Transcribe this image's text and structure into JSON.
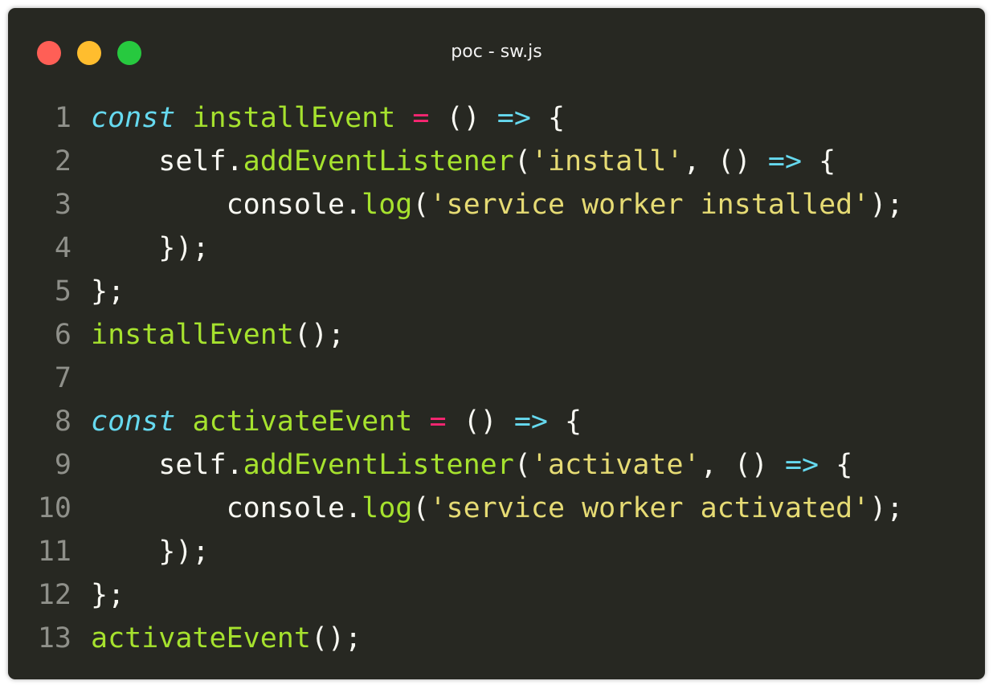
{
  "window": {
    "title": "poc - sw.js",
    "controls": [
      {
        "name": "close",
        "color": "#ff5f56"
      },
      {
        "name": "minimize",
        "color": "#ffbd2e"
      },
      {
        "name": "zoom",
        "color": "#27c93f"
      }
    ]
  },
  "theme": {
    "background": "#272822",
    "foreground": "#f8f8f2",
    "keyword": "#66d9ef",
    "function": "#a6e22e",
    "operator": "#f92672",
    "string": "#e6db74",
    "line_number": "#8f908a"
  },
  "code": {
    "lines": [
      {
        "n": "1",
        "tokens": [
          [
            "kw",
            "const"
          ],
          [
            "p",
            " "
          ],
          [
            "fn",
            "installEvent"
          ],
          [
            "p",
            " "
          ],
          [
            "op",
            "="
          ],
          [
            "p",
            " () "
          ],
          [
            "arrow",
            "=>"
          ],
          [
            "p",
            " {"
          ]
        ]
      },
      {
        "n": "2",
        "tokens": [
          [
            "p",
            "    self."
          ],
          [
            "fn",
            "addEventListener"
          ],
          [
            "p",
            "("
          ],
          [
            "str",
            "'install'"
          ],
          [
            "p",
            ", () "
          ],
          [
            "arrow",
            "=>"
          ],
          [
            "p",
            " {"
          ]
        ]
      },
      {
        "n": "3",
        "tokens": [
          [
            "p",
            "        console."
          ],
          [
            "fn",
            "log"
          ],
          [
            "p",
            "("
          ],
          [
            "str",
            "'service worker installed'"
          ],
          [
            "p",
            ");"
          ]
        ]
      },
      {
        "n": "4",
        "tokens": [
          [
            "p",
            "    });"
          ]
        ]
      },
      {
        "n": "5",
        "tokens": [
          [
            "p",
            "};"
          ]
        ]
      },
      {
        "n": "6",
        "tokens": [
          [
            "fn",
            "installEvent"
          ],
          [
            "p",
            "();"
          ]
        ]
      },
      {
        "n": "7",
        "tokens": []
      },
      {
        "n": "8",
        "tokens": [
          [
            "kw",
            "const"
          ],
          [
            "p",
            " "
          ],
          [
            "fn",
            "activateEvent"
          ],
          [
            "p",
            " "
          ],
          [
            "op",
            "="
          ],
          [
            "p",
            " () "
          ],
          [
            "arrow",
            "=>"
          ],
          [
            "p",
            " {"
          ]
        ]
      },
      {
        "n": "9",
        "tokens": [
          [
            "p",
            "    self."
          ],
          [
            "fn",
            "addEventListener"
          ],
          [
            "p",
            "("
          ],
          [
            "str",
            "'activate'"
          ],
          [
            "p",
            ", () "
          ],
          [
            "arrow",
            "=>"
          ],
          [
            "p",
            " {"
          ]
        ]
      },
      {
        "n": "10",
        "tokens": [
          [
            "p",
            "        console."
          ],
          [
            "fn",
            "log"
          ],
          [
            "p",
            "("
          ],
          [
            "str",
            "'service worker activated'"
          ],
          [
            "p",
            ");"
          ]
        ]
      },
      {
        "n": "11",
        "tokens": [
          [
            "p",
            "    });"
          ]
        ]
      },
      {
        "n": "12",
        "tokens": [
          [
            "p",
            "};"
          ]
        ]
      },
      {
        "n": "13",
        "tokens": [
          [
            "fn",
            "activateEvent"
          ],
          [
            "p",
            "();"
          ]
        ]
      }
    ]
  }
}
